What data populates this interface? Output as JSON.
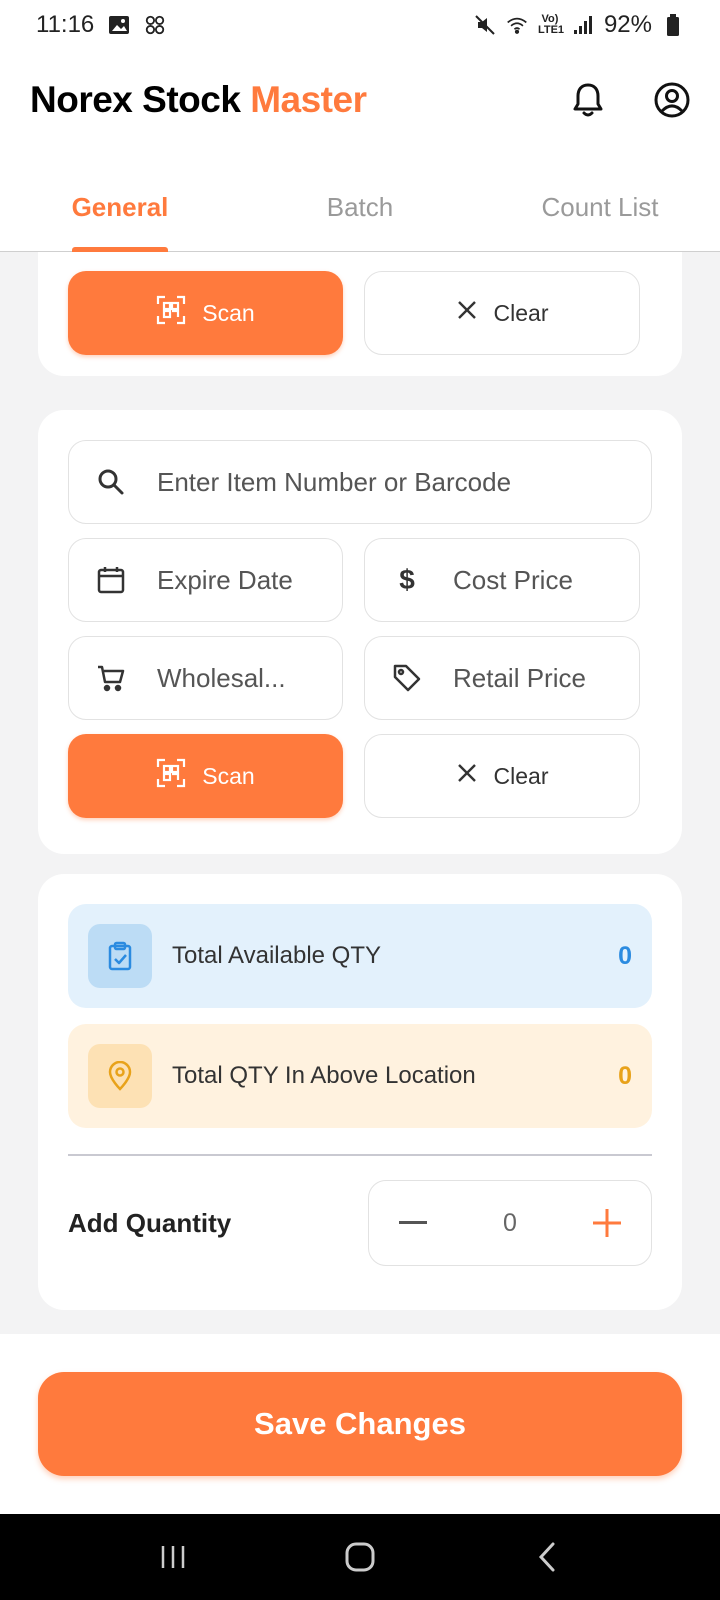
{
  "status_bar": {
    "time": "11:16",
    "network": "Vo) LTE1",
    "battery": "92%"
  },
  "header": {
    "brand_main": "Norex Stock",
    "brand_accent": "Master",
    "icons": [
      "bell-icon",
      "account-icon"
    ]
  },
  "tabs": [
    {
      "label": "General",
      "active": true
    },
    {
      "label": "Batch",
      "active": false
    },
    {
      "label": "Count List",
      "active": false
    }
  ],
  "card1": {
    "scan_label": "Scan",
    "clear_label": "Clear"
  },
  "card2": {
    "search_placeholder": "Enter Item Number or Barcode",
    "expire_placeholder": "Expire Date",
    "cost_placeholder": "Cost Price",
    "wholesale_placeholder": "Wholesal...",
    "retail_placeholder": "Retail Price",
    "scan_label": "Scan",
    "clear_label": "Clear"
  },
  "card3": {
    "total_available_label": "Total Available QTY",
    "total_available_value": "0",
    "total_location_label": "Total QTY In Above Location",
    "total_location_value": "0",
    "add_quantity_label": "Add Quantity",
    "quantity_value": "0"
  },
  "footer": {
    "save_label": "Save Changes"
  },
  "colors": {
    "accent": "#ff7a3d",
    "blue_value": "#2b8be0",
    "amber_value": "#e8a21a"
  }
}
